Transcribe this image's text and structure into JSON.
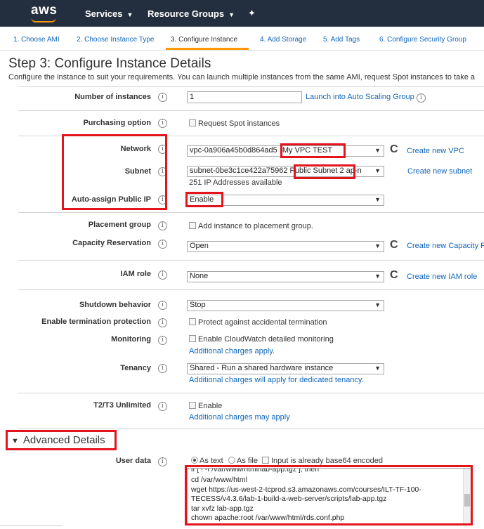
{
  "topbar": {
    "logo": "aws",
    "services": "Services",
    "resource_groups": "Resource Groups",
    "pin_icon": "pin-icon"
  },
  "wizard": {
    "steps": [
      "1. Choose AMI",
      "2. Choose Instance Type",
      "3. Configure Instance",
      "4. Add Storage",
      "5. Add Tags",
      "6. Configure Security Group"
    ],
    "active_index": 2
  },
  "page": {
    "title": "Step 3: Configure Instance Details",
    "description": "Configure the instance to suit your requirements. You can launch multiple instances from the same AMI, request Spot instances to take a"
  },
  "info_glyph": "i",
  "refresh_glyph": "C",
  "form": {
    "number_of_instances": {
      "label": "Number of instances",
      "value": "1",
      "link": "Launch into Auto Scaling Group"
    },
    "purchasing_option": {
      "label": "Purchasing option",
      "checkbox": "Request Spot instances"
    },
    "network": {
      "label": "Network",
      "vpc_id": "vpc-0a906a45b0d864ad5",
      "vpc_name": "My VPC TEST",
      "link": "Create new VPC"
    },
    "subnet": {
      "label": "Subnet",
      "subnet_id": "subnet-0be3c1ce422a75962",
      "subnet_name": "Public Subnet 2",
      "az": "ap-n",
      "available": "251 IP Addresses available",
      "link": "Create new subnet"
    },
    "auto_assign_ip": {
      "label": "Auto-assign Public IP",
      "value": "Enable"
    },
    "placement_group": {
      "label": "Placement group",
      "checkbox": "Add instance to placement group."
    },
    "capacity_reservation": {
      "label": "Capacity Reservation",
      "value": "Open",
      "link": "Create new Capacity R"
    },
    "iam_role": {
      "label": "IAM role",
      "value": "None",
      "link": "Create new IAM role"
    },
    "shutdown_behavior": {
      "label": "Shutdown behavior",
      "value": "Stop"
    },
    "termination_protection": {
      "label": "Enable termination protection",
      "checkbox": "Protect against accidental termination"
    },
    "monitoring": {
      "label": "Monitoring",
      "checkbox": "Enable CloudWatch detailed monitoring",
      "note": "Additional charges apply."
    },
    "tenancy": {
      "label": "Tenancy",
      "value": "Shared - Run a shared hardware instance",
      "note": "Additional charges will apply for dedicated tenancy."
    },
    "t2t3_unlimited": {
      "label": "T2/T3 Unlimited",
      "checkbox": "Enable",
      "note": "Additional charges may apply"
    }
  },
  "advanced": {
    "heading": "Advanced Details",
    "user_data": {
      "label": "User data",
      "as_text": "As text",
      "as_file": "As file",
      "base64": "Input is already base64 encoded",
      "lines": [
        "if [ ! -f /var/www/html/lab-app.tgz ]; then",
        "cd /var/www/html",
        "wget https://us-west-2-tcprod.s3.amazonaws.com/courses/ILT-TF-100-",
        "TECESS/v4.3.6/lab-1-build-a-web-server/scripts/lab-app.tgz",
        "tar xvfz lab-app.tgz",
        "chown apache:root /var/www/html/rds.conf.php"
      ]
    }
  },
  "colors": {
    "topbar": "#232f3e",
    "link": "#1166bb",
    "highlight": "#e3141c",
    "accent": "#ff9900"
  }
}
